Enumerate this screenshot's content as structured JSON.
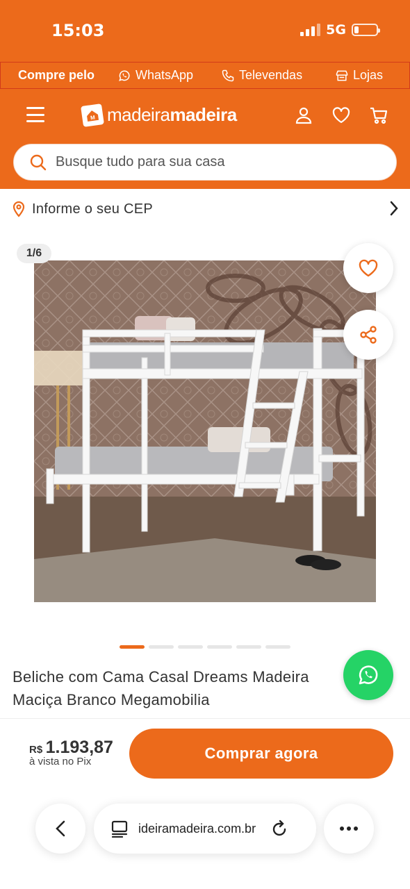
{
  "status_bar": {
    "time": "15:03",
    "network": "5G",
    "battery_level": 0.2
  },
  "contact_strip": {
    "lead": "Compre pelo",
    "items": [
      {
        "label": "WhatsApp",
        "icon": "whatsapp-icon"
      },
      {
        "label": "Televendas",
        "icon": "phone-icon"
      },
      {
        "label": "Lojas",
        "icon": "store-icon"
      }
    ]
  },
  "header": {
    "logo_light": "madeira",
    "logo_bold": "madeira",
    "icons": [
      "menu-icon",
      "user-icon",
      "heart-icon",
      "cart-icon"
    ]
  },
  "search": {
    "placeholder": "Busque tudo para sua casa"
  },
  "cep": {
    "label": "Informe o seu CEP"
  },
  "gallery": {
    "counter": "1/6",
    "total_images": 6,
    "active_index": 0
  },
  "product": {
    "title": "Beliche com Cama Casal Dreams Madeira Maciça Branco Megamobilia"
  },
  "buy": {
    "currency": "R$",
    "price": "1.193,87",
    "price_note": "à vista no Pix",
    "button_label": "Comprar agora"
  },
  "browser": {
    "url": "ideiramadeira.com.br"
  },
  "colors": {
    "brand": "#ec6a1b",
    "whatsapp": "#25d366"
  }
}
